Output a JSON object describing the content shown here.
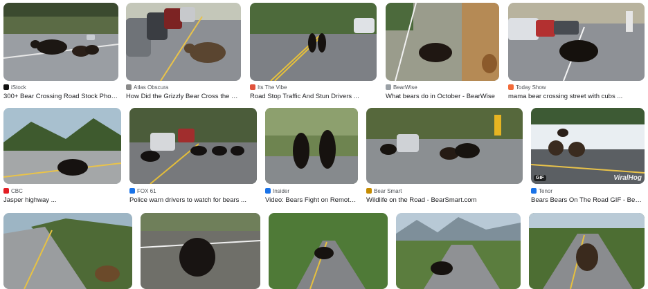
{
  "results": [
    {
      "source": "iStock",
      "title": "300+ Bear Crossing Road Stock Photo...",
      "fav": "#111111",
      "fav_icon": "istock-icon"
    },
    {
      "source": "Atlas Obscura",
      "title": "How Did the Grizzly Bear Cross the Ro...",
      "fav": "#8a8a8a",
      "fav_icon": "atlas-obscura-icon"
    },
    {
      "source": "Its The Vibe",
      "title": "Road Stop Traffic And Stun Drivers ...",
      "fav": "#e0533d",
      "fav_icon": "its-the-vibe-icon"
    },
    {
      "source": "BearWise",
      "title": "What bears do in October - BearWise",
      "fav": "#9aa0a6",
      "fav_icon": "bearwise-icon"
    },
    {
      "source": "Today Show",
      "title": "mama bear crossing street with cubs ...",
      "fav": "#f26b3a",
      "fav_icon": "today-show-icon"
    },
    {
      "source": "CBC",
      "title": "Jasper highway ...",
      "fav": "#e31e24",
      "fav_icon": "cbc-icon"
    },
    {
      "source": "FOX 61",
      "title": "Police warn drivers to watch for bears ...",
      "fav": "#1a73e8",
      "fav_icon": "fox61-icon"
    },
    {
      "source": "Insider",
      "title": "Video: Bears Fight on Remote ...",
      "fav": "#1a73e8",
      "fav_icon": "insider-icon"
    },
    {
      "source": "Bear Smart",
      "title": "Wildlife on the Road - BearSmart.com",
      "fav": "#c58b00",
      "fav_icon": "bear-smart-icon"
    },
    {
      "source": "Tenor",
      "title": "Bears Bears On The Road GIF - Bears ...",
      "fav": "#1a73e8",
      "fav_icon": "tenor-icon",
      "badge": "GIF",
      "watermark": "ViralHog"
    },
    {
      "source": "",
      "title": "",
      "fav": "",
      "fav_icon": ""
    },
    {
      "source": "",
      "title": "",
      "fav": "",
      "fav_icon": ""
    },
    {
      "source": "",
      "title": "",
      "fav": "",
      "fav_icon": ""
    },
    {
      "source": "",
      "title": "",
      "fav": "",
      "fav_icon": ""
    },
    {
      "source": "",
      "title": "",
      "fav": "",
      "fav_icon": ""
    }
  ]
}
